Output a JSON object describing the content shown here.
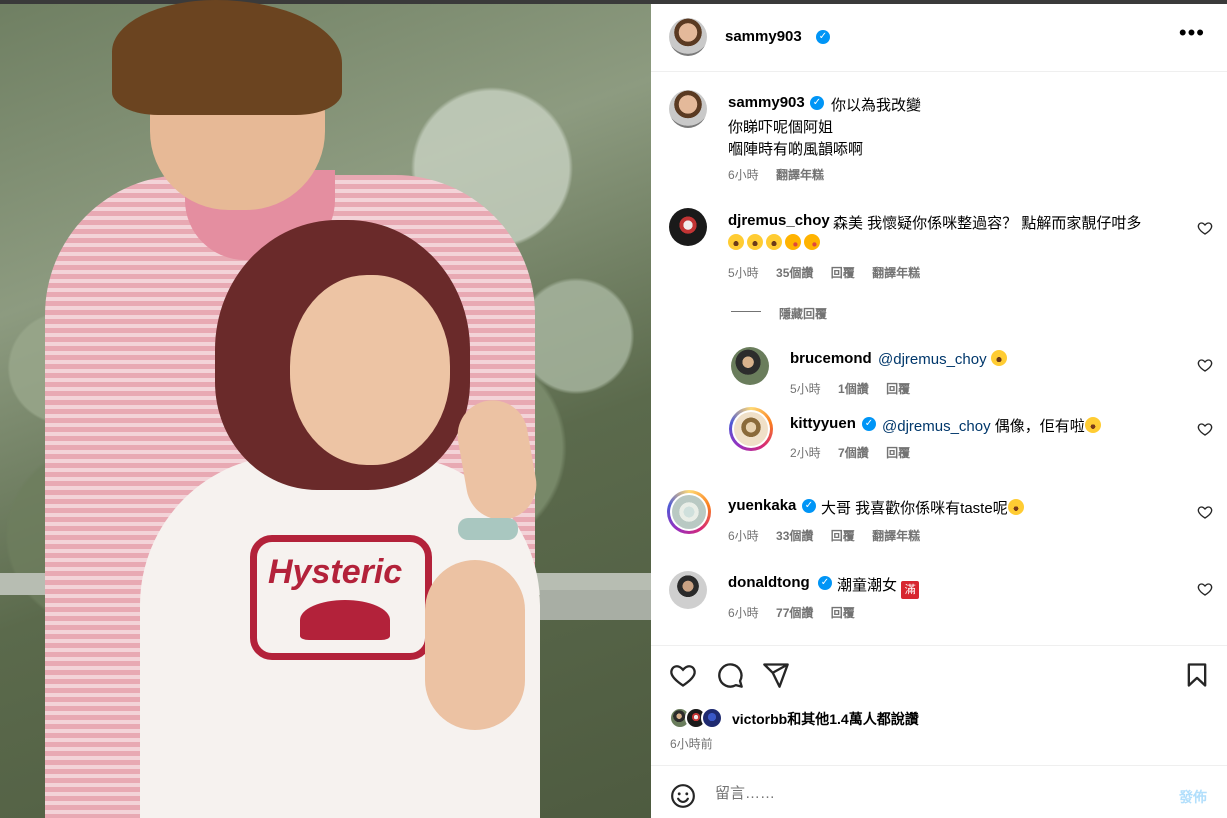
{
  "post": {
    "author": "sammy903",
    "caption_lines": [
      "你以為我改變",
      "你睇吓呢個阿姐",
      "嗰陣時有啲風韻㖭啊"
    ],
    "caption_time": "6小時",
    "translate": "翻譯年糕"
  },
  "comments": [
    {
      "user": "djremus_choy",
      "text": "森美 我懷疑你係咪整過容？ 點解而家靚仔咁多",
      "emojis": [
        "grinning-squinting-face",
        "grinning-squinting-face",
        "grinning-squinting-face",
        "face-blowing-kiss",
        "face-blowing-kiss"
      ],
      "time": "5小時",
      "likes": "35個讚",
      "reply": "回覆",
      "translate": "翻譯年糕",
      "hide_replies": "隱藏回覆",
      "replies": [
        {
          "user": "brucemond",
          "mention": "@djremus_choy",
          "text": "",
          "time": "5小時",
          "likes": "1個讚",
          "reply": "回覆"
        },
        {
          "user": "kittyyuen",
          "mention": "@djremus_choy",
          "text": "偶像，佢有啦",
          "time": "2小時",
          "likes": "7個讚",
          "reply": "回覆"
        }
      ]
    },
    {
      "user": "yuenkaka",
      "text": "大哥 我喜歡你係咪有taste呢",
      "time": "6小時",
      "likes": "33個讚",
      "reply": "回覆",
      "translate": "翻譯年糕"
    },
    {
      "user": "donaldtong",
      "text": "潮童潮女",
      "badge": "滿",
      "time": "6小時",
      "likes": "77個讚",
      "reply": "回覆"
    }
  ],
  "likes_summary": {
    "user": "victorbb",
    "text": "和其他1.4萬人都說讚"
  },
  "posted": "6小時前",
  "comment_box": {
    "placeholder": "留言……",
    "post_label": "發佈"
  },
  "photo": {
    "shirt_text": "Hysteric"
  },
  "colors": {
    "verified": "#0095f6",
    "mention": "#00376b",
    "meta": "#737373",
    "post_button": "#b2dffc"
  }
}
